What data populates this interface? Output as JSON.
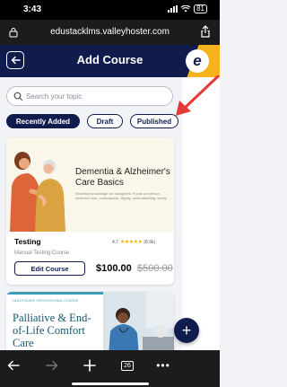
{
  "status_bar": {
    "time": "3:43",
    "battery": "81"
  },
  "browser": {
    "url": "edustacklms.valleyhoster.com"
  },
  "header": {
    "title": "Add Course",
    "logo_letter": "e"
  },
  "search": {
    "placeholder": "Search your topic"
  },
  "tabs": [
    {
      "label": "Recently Added",
      "active": true
    },
    {
      "label": "Draft",
      "active": false
    },
    {
      "label": "Published",
      "active": false
    }
  ],
  "courses": [
    {
      "thumb_title": "Dementia & Alzheimer's Care Basics",
      "thumb_desc": "Essential knowledge for caregivers. Focus on person-centered care, compassion, dignity, understanding, family",
      "title": "Testing",
      "rating": "4.7",
      "stars": "★★★★★",
      "rating_count": "(8.6k)",
      "description": "Manual Testing Course",
      "edit_label": "Edit Course",
      "price": "$100.00",
      "original_price": "$500.00"
    },
    {
      "kicker": "HEALTHCARE PROFESSIONAL COURSE",
      "title": "Palliative & End-of-Life Comfort Care"
    }
  ],
  "fab_label": "+",
  "toolbar": {
    "tabs_count": "26"
  },
  "colors": {
    "primary": "#111c4e",
    "accent": "#f5b21a",
    "annotation": "#e53935"
  }
}
